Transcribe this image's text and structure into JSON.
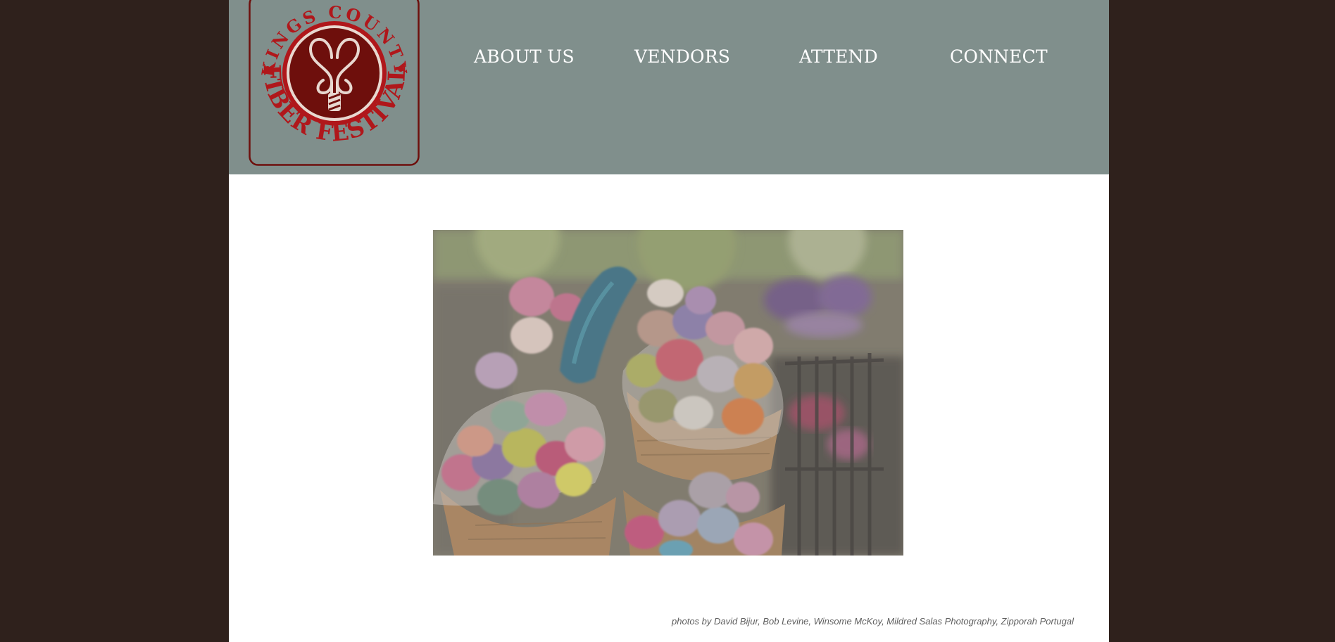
{
  "site": {
    "logo_text_top": "KINGS COUNTY",
    "logo_text_bottom": "FIBER FESTIVAL",
    "colors": {
      "background": "#2f211c",
      "header": "#808f8c",
      "logo_red": "#b0171b",
      "logo_dark_red": "#6e0f0c"
    }
  },
  "nav": {
    "items": [
      {
        "label": "ABOUT US"
      },
      {
        "label": "VENDORS"
      },
      {
        "label": "ATTEND"
      },
      {
        "label": "CONNECT"
      }
    ]
  },
  "hero": {
    "icon": "yarn-baskets-photo"
  },
  "footer": {
    "credit": "photos by David Bijur, Bob Levine, Winsome McKoy, Mildred Salas Photography, Zipporah Portugal"
  }
}
